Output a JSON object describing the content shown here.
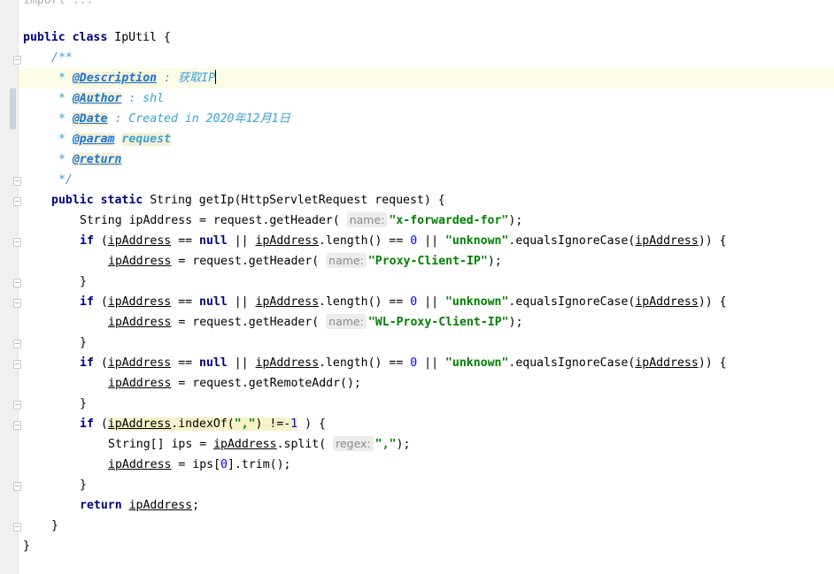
{
  "import_line": "import ...",
  "code": {
    "class_kw1": "public",
    "class_kw2": "class",
    "class_name": "IpUtil {",
    "doc_open": "/**",
    "doc_star": " * ",
    "desc_tag": "@Description",
    "desc_text": " : 获取IP",
    "author_tag": "@Author",
    "author_text": " : shl",
    "date_tag": "@Date",
    "date_text": " : Created in 2020年12月1日",
    "param_tag": "@param",
    "param_name": "request",
    "return_tag": "@return",
    "doc_close": "*/",
    "method_kw1": "public",
    "method_kw2": "static",
    "method_sig": "String getIp(HttpServletRequest request) {",
    "decl_prefix": "String ipAddress = request.getHeader(",
    "hint_name": "name:",
    "hint_regex": "regex:",
    "header1": "\"x-forwarded-for\"",
    "header2": "\"Proxy-Client-IP\"",
    "header3": "\"WL-Proxy-Client-IP\"",
    "kw_if": "if",
    "kw_null": "null",
    "kw_return": "return",
    "var": "ipAddress",
    "cond_open": " (",
    "cond_eq": " == ",
    "cond_or": " || ",
    "cond_len": ".length() == ",
    "zero": "0",
    "unknown_str": "\"unknown\"",
    "equals_call": ".equalsIgnoreCase(",
    "cond_close": ")) {",
    "assign_header": " = request.getHeader(",
    "call_end": ");",
    "close_brace": "}",
    "assign_remote": " = request.getRemoteAddr();",
    "indexof_call": ".indexOf(",
    "comma_str": "\",\"",
    "neq": ") !=-",
    "one": "1",
    "indexof_end": " ) {",
    "split_prefix": "String[] ips = ",
    "split_call": ".split(",
    "assign_trim_a": " = ips[",
    "assign_trim_b": "].trim();",
    "return_end": ";"
  }
}
